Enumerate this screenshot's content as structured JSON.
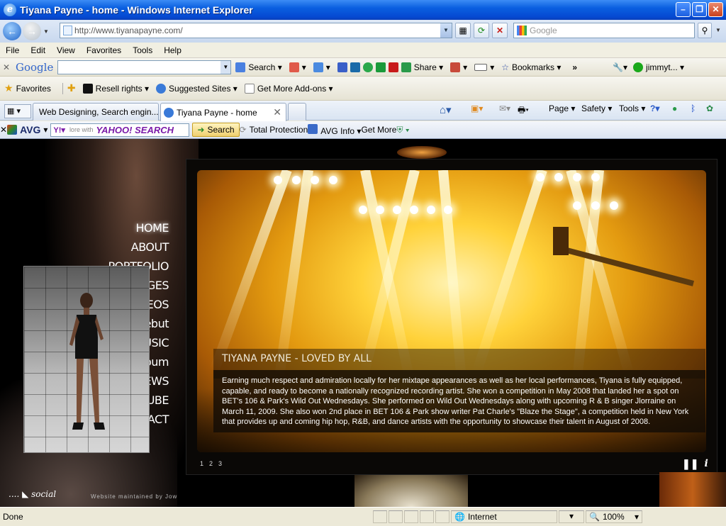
{
  "window": {
    "title": "Tiyana Payne - home - Windows Internet Explorer"
  },
  "address": {
    "url": "http://www.tiyanapayne.com/",
    "search_placeholder": "Google"
  },
  "menu": [
    "File",
    "Edit",
    "View",
    "Favorites",
    "Tools",
    "Help"
  ],
  "google_toolbar": {
    "logo": "Google",
    "search": "Search",
    "share": "Share",
    "bookmarks": "Bookmarks",
    "user": "jimmyt..."
  },
  "favorites_bar": {
    "favorites": "Favorites",
    "items": [
      "Resell rights",
      "Suggested Sites",
      "Get More Add-ons"
    ]
  },
  "tabs": [
    {
      "label": "Web Designing, Search engin...",
      "active": false
    },
    {
      "label": "Tiyana Payne - home",
      "active": true
    }
  ],
  "commandbar": {
    "page": "Page",
    "safety": "Safety",
    "tools": "Tools"
  },
  "avg_toolbar": {
    "logo": "AVG",
    "yahoo_placeholder": "lore with",
    "search": "Search",
    "protection": "Total Protection",
    "info": "AVG Info",
    "more": "Get More"
  },
  "site": {
    "nav": [
      "HOME",
      "ABOUT",
      "PORTFOLIO",
      "IMAGES",
      "VIDEOS",
      "BET debut",
      "MUSIC",
      "Buy Album",
      "NEWS",
      "YOUTUBE",
      "CONTACT"
    ],
    "social": "social",
    "maintained": "Website maintained by Jow",
    "slide_title": "TIYANA PAYNE - LOVED BY ALL",
    "slide_text": "Earning much respect and admiration locally for her mixtape appearances as well as her local performances, Tiyana is fully equipped, capable, and ready to become a nationally recognized recording artist. She won a competition in May 2008 that landed her a spot on BET's 106 & Park's Wild Out Wednesdays. She performed on Wild Out Wednesdays along with upcoming R & B singer Jlorraine on March 11, 2009. She also won 2nd place in BET 106 & Park show writer Pat Charle's \"Blaze the Stage\", a competition held in New York that provides up and coming hip hop, R&B, and dance artists with the opportunity to showcase their talent in August of 2008.",
    "pages": [
      "1",
      "2",
      "3"
    ]
  },
  "status": {
    "left": "Done",
    "zone": "Internet",
    "zoom": "100%"
  }
}
